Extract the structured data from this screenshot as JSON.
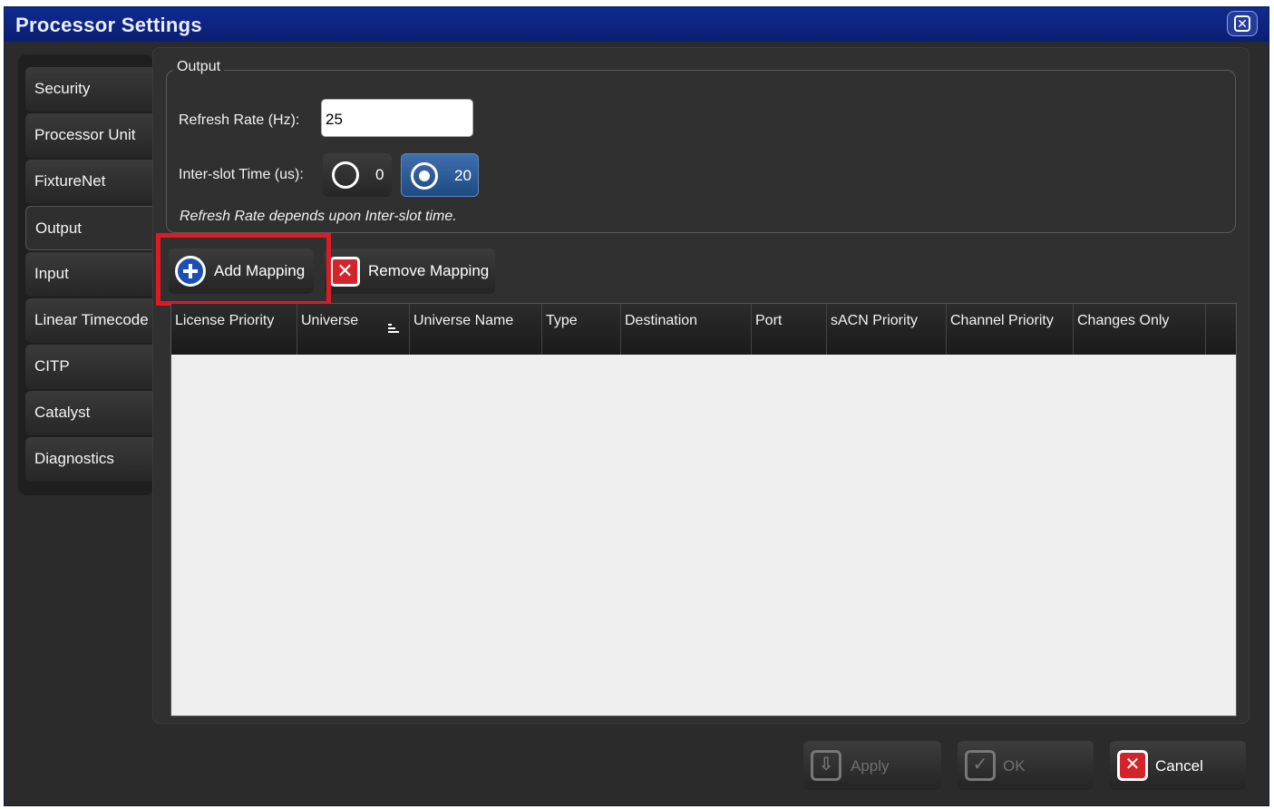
{
  "window": {
    "title": "Processor Settings"
  },
  "sidebar": {
    "items": [
      {
        "label": "Security"
      },
      {
        "label": "Processor Unit"
      },
      {
        "label": "FixtureNet"
      },
      {
        "label": "Output",
        "active": true
      },
      {
        "label": "Input"
      },
      {
        "label": "Linear Timecode"
      },
      {
        "label": "CITP"
      },
      {
        "label": "Catalyst"
      },
      {
        "label": "Diagnostics"
      }
    ]
  },
  "output": {
    "group_label": "Output",
    "refresh_rate_label": "Refresh Rate (Hz):",
    "refresh_rate_value": "25",
    "interslot_label": "Inter-slot Time (us):",
    "interslot_options": [
      {
        "value": "0",
        "selected": false
      },
      {
        "value": "20",
        "selected": true
      }
    ],
    "note": "Refresh Rate depends upon Inter-slot time."
  },
  "actions": {
    "add_mapping": "Add Mapping",
    "remove_mapping": "Remove Mapping"
  },
  "table": {
    "columns": [
      "License Priority",
      "Universe",
      "Universe Name",
      "Type",
      "Destination",
      "Port",
      "sACN Priority",
      "Channel Priority",
      "Changes Only"
    ],
    "rows": []
  },
  "footer": {
    "apply": "Apply",
    "ok": "OK",
    "cancel": "Cancel"
  },
  "colors": {
    "titlebar": "#0a1f73",
    "highlight": "#e01a23",
    "accent_blue": "#1b4fb4",
    "cancel_red": "#d3242c"
  },
  "icons": {
    "close": "close-icon",
    "add": "plus-icon",
    "remove": "x-icon",
    "apply": "download-arrow-icon",
    "ok": "checkmark-icon",
    "cancel": "x-icon",
    "sort": "sort-icon"
  }
}
